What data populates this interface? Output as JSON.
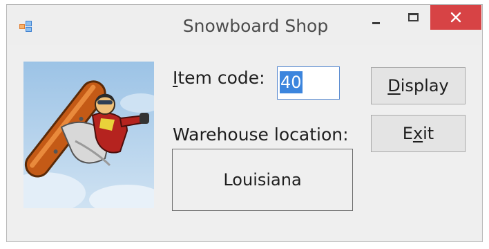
{
  "window": {
    "title": "Snowboard Shop",
    "controls": {
      "minimize_icon": "minimize-icon",
      "maximize_icon": "maximize-icon",
      "close_icon": "close-icon"
    },
    "close_color": "#d74345"
  },
  "form": {
    "item_code_label": {
      "mnemonic": "I",
      "rest": "tem code:"
    },
    "item_code_value": "40",
    "warehouse_label": "Warehouse location:",
    "warehouse_value": "Louisiana",
    "display_button": {
      "mnemonic": "D",
      "rest": "isplay"
    },
    "exit_button": {
      "pre": "E",
      "mnemonic": "x",
      "post": "it"
    }
  },
  "picture": {
    "icon": "snowboarder-picture",
    "sky": "#b9d4ea",
    "board": "#d2691e"
  },
  "colors": {
    "selection": "#3c85dd",
    "focus_border": "#5a8bd1"
  }
}
